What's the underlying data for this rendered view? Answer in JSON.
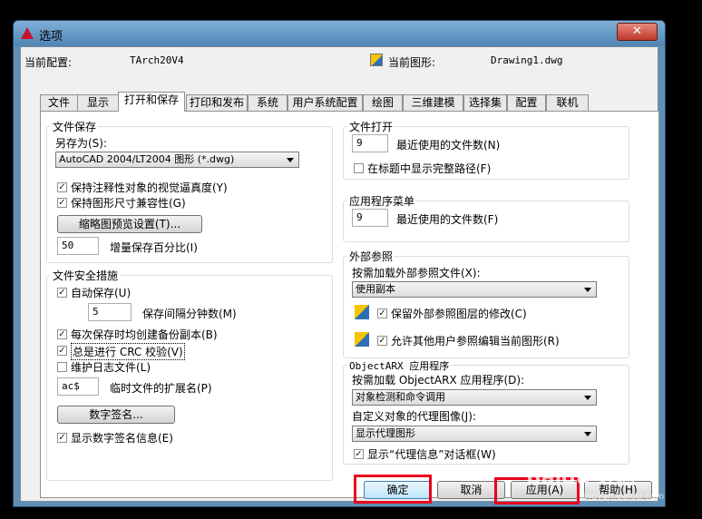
{
  "window": {
    "title": "选项",
    "close_glyph": "✕"
  },
  "header": {
    "profile_label": "当前配置:",
    "profile_value": "TArch20V4",
    "drawing_label": "当前图形:",
    "drawing_value": "Drawing1.dwg"
  },
  "tabs": [
    "文件",
    "显示",
    "打开和保存",
    "打印和发布",
    "系统",
    "用户系统配置",
    "绘图",
    "三维建模",
    "选择集",
    "配置",
    "联机"
  ],
  "active_tab": 2,
  "file_save": {
    "title": "文件保存",
    "saveas_label": "另存为(S):",
    "saveas_value": "AutoCAD 2004/LT2004 图形 (*.dwg)",
    "chk_annotative": "保持注释性对象的视觉逼真度(Y)",
    "chk_fidelity": "保持图形尺寸兼容性(G)",
    "thumb_button": "缩略图预览设置(T)...",
    "incremental_value": "50",
    "incremental_label": "增量保存百分比(I)"
  },
  "file_safety": {
    "title": "文件安全措施",
    "autosave_label": "自动保存(U)",
    "interval_value": "5",
    "interval_label": "保存间隔分钟数(M)",
    "backup_label": "每次保存时均创建备份副本(B)",
    "crc_label": "总是进行 CRC 校验(V)",
    "log_label": "维护日志文件(L)",
    "tempext_value": "ac$",
    "tempext_label": "临时文件的扩展名(P)",
    "digsig_button": "数字签名...",
    "show_digsig_label": "显示数字签名信息(E)"
  },
  "file_open": {
    "title": "文件打开",
    "recent_value": "9",
    "recent_label": "最近使用的文件数(N)",
    "fullpath_label": "在标题中显示完整路径(F)"
  },
  "app_menu": {
    "title": "应用程序菜单",
    "recent_value": "9",
    "recent_label": "最近使用的文件数(F)"
  },
  "xref": {
    "title": "外部参照",
    "demand_label": "按需加载外部参照文件(X):",
    "demand_value": "使用副本",
    "retain_label": "保留外部参照图层的修改(C)",
    "allow_edit_label": "允许其他用户参照编辑当前图形(R)"
  },
  "objectarx": {
    "title": "ObjectARX 应用程序",
    "demand_label": "按需加载 ObjectARX 应用程序(D):",
    "demand_value": "对象检测和命令调用",
    "proxy_label": "自定义对象的代理图像(J):",
    "proxy_value": "显示代理图形",
    "proxy_info_label": "显示“代理信息”对话框(W)"
  },
  "footer": {
    "ok": "确定",
    "cancel": "取消",
    "apply": "应用(A)",
    "help": "帮助(H)"
  },
  "watermark": {
    "text": "Baidu 经验",
    "sub": "jingyan.baidu.com"
  },
  "checks": {
    "checked": "✓"
  }
}
